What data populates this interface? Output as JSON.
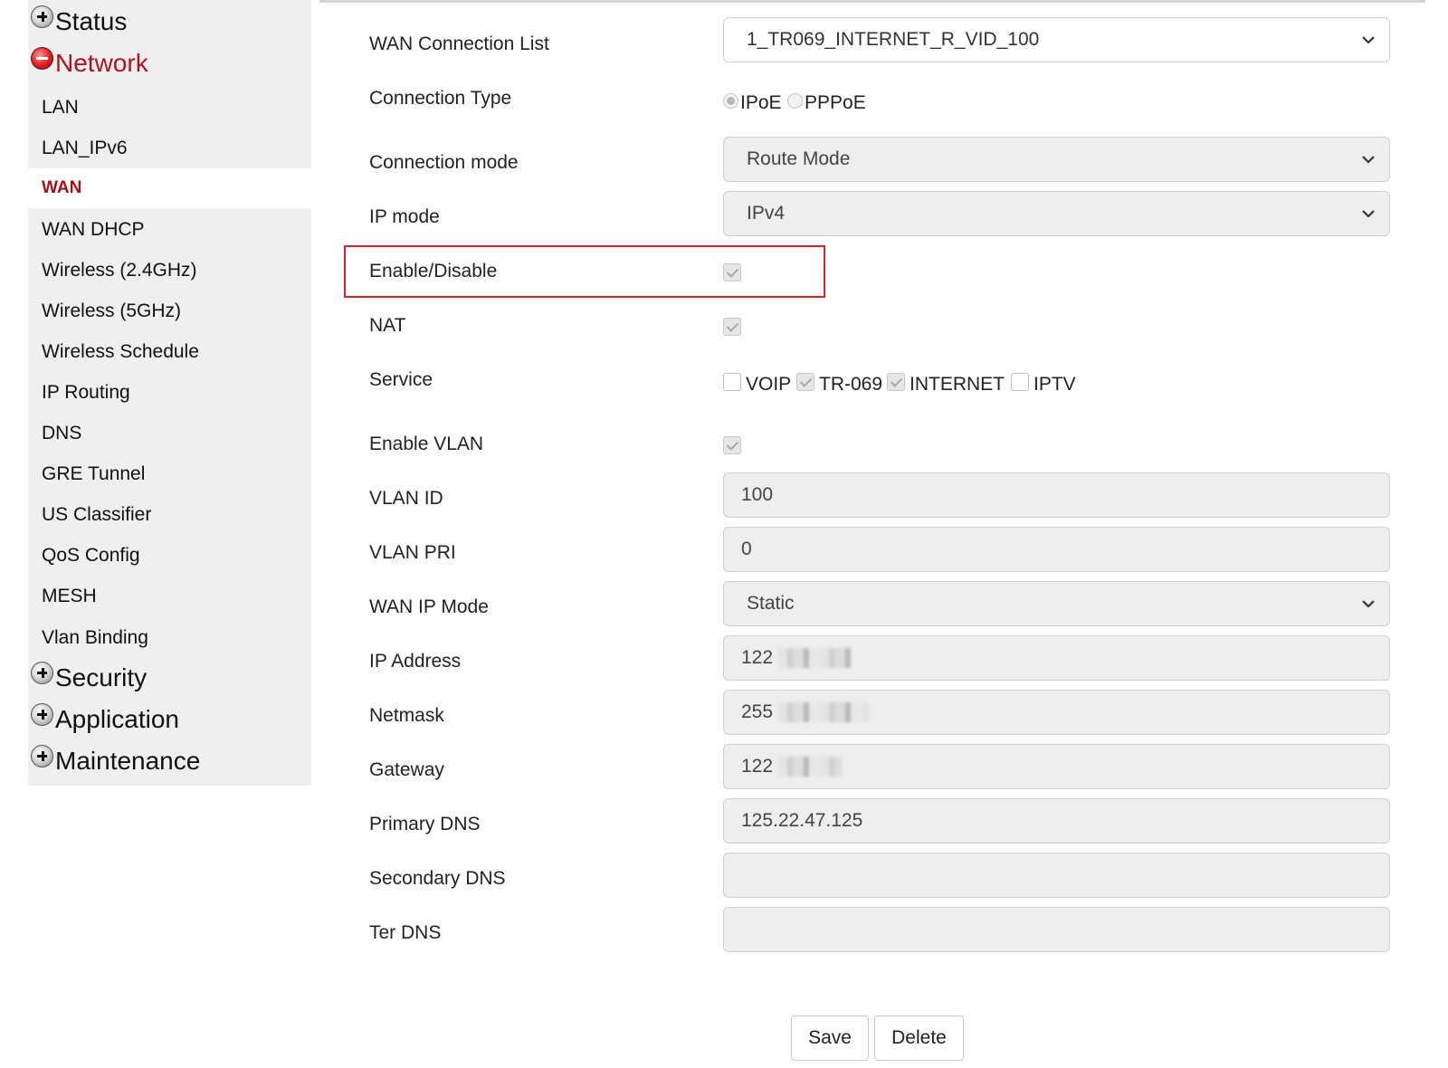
{
  "sidebar": {
    "sections": {
      "status": "Status",
      "network": "Network",
      "security": "Security",
      "application": "Application",
      "maintenance": "Maintenance"
    },
    "network_items": [
      "LAN",
      "LAN_IPv6",
      "WAN",
      "WAN DHCP",
      "Wireless (2.4GHz)",
      "Wireless (5GHz)",
      "Wireless Schedule",
      "IP Routing",
      "DNS",
      "GRE Tunnel",
      "US Classifier",
      "QoS Config",
      "MESH",
      "Vlan Binding"
    ],
    "active_item": "WAN"
  },
  "form": {
    "wan_connection_list": {
      "label": "WAN Connection List",
      "value": "1_TR069_INTERNET_R_VID_100"
    },
    "connection_type": {
      "label": "Connection Type",
      "options": [
        "IPoE",
        "PPPoE"
      ],
      "selected": "IPoE"
    },
    "connection_mode": {
      "label": "Connection mode",
      "value": "Route Mode"
    },
    "ip_mode": {
      "label": "IP mode",
      "value": "IPv4"
    },
    "enable_disable": {
      "label": "Enable/Disable",
      "checked": true
    },
    "nat": {
      "label": "NAT",
      "checked": true
    },
    "service": {
      "label": "Service",
      "options": [
        {
          "name": "VOIP",
          "checked": false
        },
        {
          "name": "TR-069",
          "checked": true
        },
        {
          "name": "INTERNET",
          "checked": true
        },
        {
          "name": "IPTV",
          "checked": false
        }
      ]
    },
    "enable_vlan": {
      "label": "Enable VLAN",
      "checked": true
    },
    "vlan_id": {
      "label": "VLAN ID",
      "value": "100"
    },
    "vlan_pri": {
      "label": "VLAN PRI",
      "value": "0"
    },
    "wan_ip_mode": {
      "label": "WAN IP Mode",
      "value": "Static"
    },
    "ip_address": {
      "label": "IP Address",
      "value": "122"
    },
    "netmask": {
      "label": "Netmask",
      "value": "255"
    },
    "gateway": {
      "label": "Gateway",
      "value": "122"
    },
    "primary_dns": {
      "label": "Primary DNS",
      "value": "125.22.47.125"
    },
    "secondary_dns": {
      "label": "Secondary DNS",
      "value": ""
    },
    "ter_dns": {
      "label": "Ter DNS",
      "value": ""
    }
  },
  "buttons": {
    "save": "Save",
    "delete": "Delete"
  },
  "colors": {
    "accent": "#a3111a",
    "highlight_box": "#d9232b",
    "sidebar_bg": "#efefef"
  }
}
